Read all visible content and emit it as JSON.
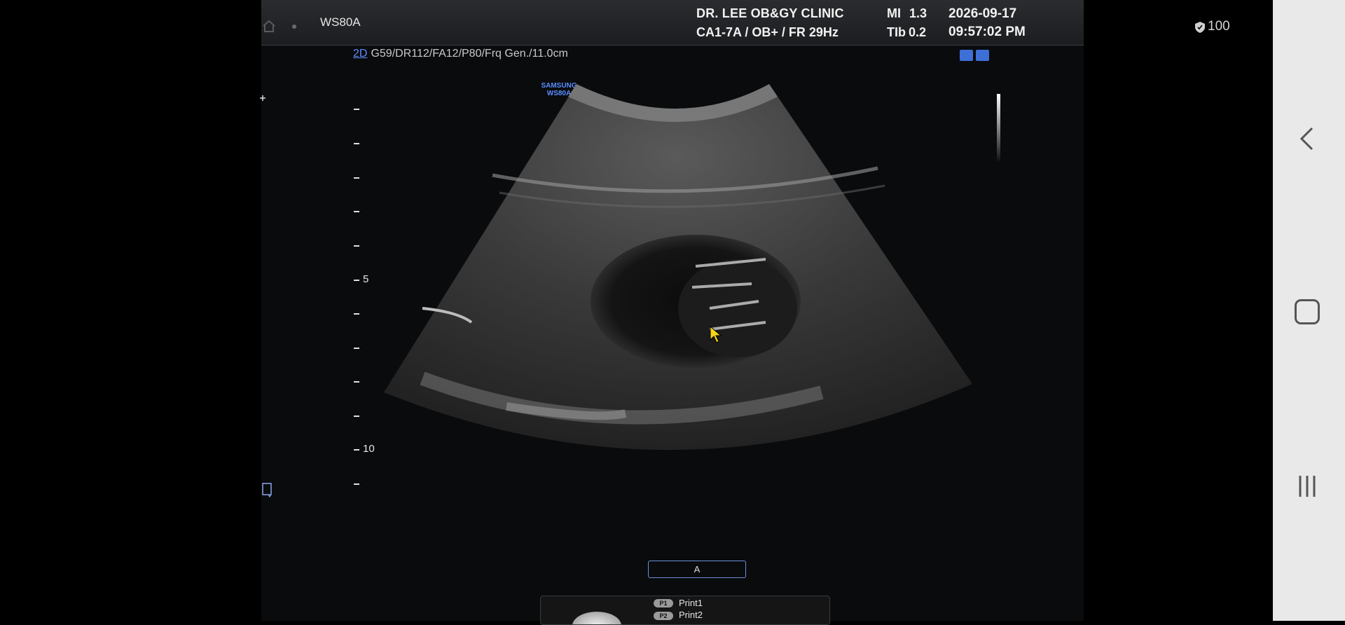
{
  "header": {
    "model": "WS80A",
    "clinic": "DR. LEE OB&GY CLINIC",
    "probe_info": "CA1-7A / OB+ / FR 29Hz",
    "mi_label": "MI",
    "mi_value": "1.3",
    "tib_label": "TIb",
    "tib_value": "0.2",
    "date": "2026-09-17",
    "time": "09:57:02 PM"
  },
  "status": {
    "battery": "100",
    "shield_icon": "shield-icon"
  },
  "image": {
    "mode": "2D",
    "params": "G59/DR112/FA12/P80/Frq Gen./11.0cm",
    "logo_line1": "SAMSUNG",
    "logo_line2": "WS80A",
    "depth_labels": [
      "5",
      "10"
    ]
  },
  "annotation": {
    "label": "A"
  },
  "print_panel": {
    "p1_badge": "P1",
    "p1_label": "Print1",
    "p2_badge": "P2",
    "p2_label": "Print2"
  },
  "nav": {
    "back_icon": "back-icon",
    "home_icon": "home-icon",
    "recents_icon": "recents-icon"
  }
}
